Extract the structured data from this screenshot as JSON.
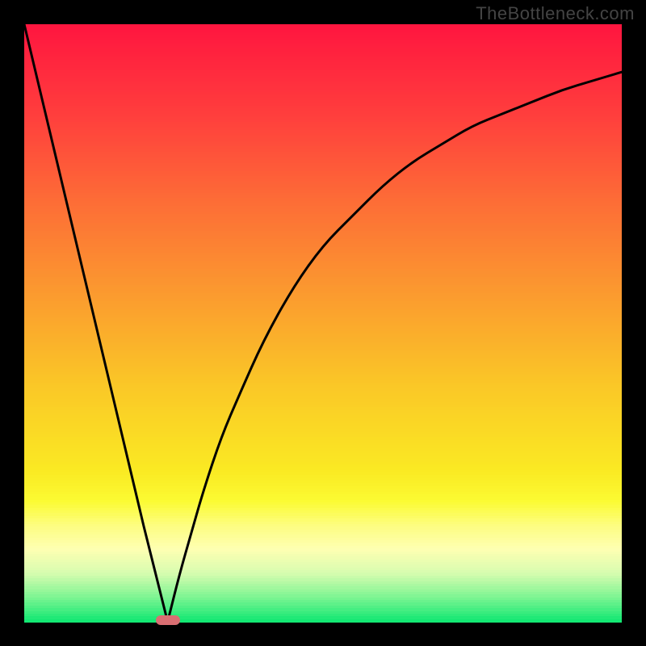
{
  "watermark": "TheBottleneck.com",
  "chart_data": {
    "type": "line",
    "title": "",
    "xlabel": "",
    "ylabel": "",
    "xlim": [
      0,
      100
    ],
    "ylim": [
      0,
      100
    ],
    "grid": false,
    "legend": false,
    "series": [
      {
        "name": "left-branch",
        "x": [
          0,
          5,
          10,
          15,
          20,
          24
        ],
        "values": [
          100,
          79,
          58,
          37,
          16,
          0
        ]
      },
      {
        "name": "right-branch",
        "x": [
          24,
          26,
          28,
          30,
          33,
          36,
          40,
          45,
          50,
          55,
          60,
          65,
          70,
          75,
          80,
          85,
          90,
          95,
          100
        ],
        "values": [
          0,
          8,
          15,
          22,
          31,
          38,
          47,
          56,
          63,
          68,
          73,
          77,
          80,
          83,
          85,
          87,
          89,
          90.5,
          92
        ]
      }
    ],
    "marker": {
      "x": 24,
      "y": 0,
      "color": "#d96e72"
    },
    "background_gradient": {
      "stops": [
        {
          "pos": 0.0,
          "color": "#ff163f"
        },
        {
          "pos": 0.15,
          "color": "#ff3e3d"
        },
        {
          "pos": 0.3,
          "color": "#fd6e36"
        },
        {
          "pos": 0.45,
          "color": "#fb9a2f"
        },
        {
          "pos": 0.6,
          "color": "#fac627"
        },
        {
          "pos": 0.75,
          "color": "#faea23"
        },
        {
          "pos": 0.8,
          "color": "#fbfb33"
        },
        {
          "pos": 0.84,
          "color": "#fdfd80"
        },
        {
          "pos": 0.88,
          "color": "#feffb2"
        },
        {
          "pos": 0.92,
          "color": "#d8fcb0"
        },
        {
          "pos": 0.96,
          "color": "#80f593"
        },
        {
          "pos": 1.0,
          "color": "#14e873"
        }
      ]
    }
  }
}
